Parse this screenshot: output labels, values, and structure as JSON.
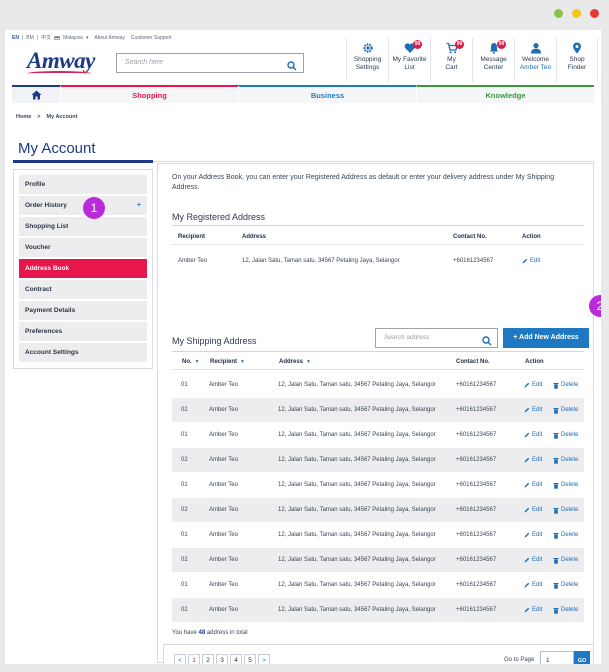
{
  "window": {
    "dots": [
      "#8bc34a",
      "#f5c518",
      "#e53935"
    ]
  },
  "util_bar": {
    "lang_en": "EN",
    "lang_bm": "BM",
    "lang_zh": "中文",
    "country": "Malaysia",
    "about": "About Amway",
    "support": "Customer Support"
  },
  "logo": "Amway",
  "search": {
    "placeholder": "Search here"
  },
  "header_icons": [
    {
      "icon": "gear-icon",
      "line1": "Shopping",
      "line2": "Settings",
      "badge": ""
    },
    {
      "icon": "heart-icon",
      "line1": "My Favorite",
      "line2": "List",
      "badge": "99"
    },
    {
      "icon": "cart-icon",
      "line1": "My",
      "line2": "Cart",
      "badge": "99"
    },
    {
      "icon": "bell-icon",
      "line1": "Message",
      "line2": "Center",
      "badge": "99"
    },
    {
      "icon": "user-icon",
      "line1": "Welcome",
      "line2": "Amber Teo",
      "badge": ""
    },
    {
      "icon": "map-pin-icon",
      "line1": "Shop",
      "line2": "Finder",
      "badge": ""
    }
  ],
  "nav": {
    "items": [
      {
        "label": "Shopping",
        "color": "#e8174b"
      },
      {
        "label": "Business",
        "color": "#1f79c2"
      },
      {
        "label": "Knowledge",
        "color": "#3a9a3a"
      }
    ]
  },
  "breadcrumb": {
    "home": "Home",
    "sep": ">",
    "current": "My Account"
  },
  "page_title": "My Account",
  "sidebar": {
    "items": [
      {
        "label": "Profile"
      },
      {
        "label": "Order History",
        "plus": "+"
      },
      {
        "label": "Shopping List"
      },
      {
        "label": "Voucher"
      },
      {
        "label": "Address Book"
      },
      {
        "label": "Contract"
      },
      {
        "label": "Payment Details"
      },
      {
        "label": "Preferences"
      },
      {
        "label": "Account Settings"
      }
    ],
    "active_index": 4
  },
  "markers": {
    "one": "1",
    "two": "2"
  },
  "intro_text": "On your Address Book, you can enter your Registered Address as default or enter your delivery address under My Shipping Address.",
  "registered": {
    "title": "My Registered Address",
    "headers": {
      "recipient": "Recipient",
      "address": "Address",
      "contact": "Contact No.",
      "action": "Action"
    },
    "row": {
      "recipient": "Amber Teo",
      "address": "12, Jalan Satu, Taman satu, 34567 Petaling Jaya, Selangor",
      "contact": "+60161234567",
      "edit": "Edit"
    }
  },
  "shipping": {
    "title": "My Shipping Address",
    "search_placeholder": "Search address",
    "add_button": "+ Add New Address",
    "headers": {
      "no": "No.",
      "recipient": "Recipient",
      "address": "Address",
      "contact": "Contact No.",
      "action": "Action"
    },
    "edit_label": "Edit",
    "delete_label": "Delete",
    "rows": [
      {
        "no": "01",
        "recipient": "Amber Teo",
        "address": "12, Jalan Satu, Taman satu, 34567 Petaling Jaya, Selangor",
        "contact": "+60161234567"
      },
      {
        "no": "02",
        "recipient": "Amber Teo",
        "address": "12, Jalan Satu, Taman satu, 34567 Petaling Jaya, Selangor",
        "contact": "+60161234567"
      },
      {
        "no": "01",
        "recipient": "Amber Teo",
        "address": "12, Jalan Satu, Taman satu, 34567 Petaling Jaya, Selangor",
        "contact": "+60161234567"
      },
      {
        "no": "02",
        "recipient": "Amber Teo",
        "address": "12, Jalan Satu, Taman satu, 34567 Petaling Jaya, Selangor",
        "contact": "+60161234567"
      },
      {
        "no": "01",
        "recipient": "Amber Teo",
        "address": "12, Jalan Satu, Taman satu, 34567 Petaling Jaya, Selangor",
        "contact": "+60161234567"
      },
      {
        "no": "02",
        "recipient": "Amber Teo",
        "address": "12, Jalan Satu, Taman satu, 34567 Petaling Jaya, Selangor",
        "contact": "+60161234567"
      },
      {
        "no": "01",
        "recipient": "Amber Teo",
        "address": "12, Jalan Satu, Taman satu, 34567 Petaling Jaya, Selangor",
        "contact": "+60161234567"
      },
      {
        "no": "02",
        "recipient": "Amber Teo",
        "address": "12, Jalan Satu, Taman satu, 34567 Petaling Jaya, Selangor",
        "contact": "+60161234567"
      },
      {
        "no": "01",
        "recipient": "Amber Teo",
        "address": "12, Jalan Satu, Taman satu, 34567 Petaling Jaya, Selangor",
        "contact": "+60161234567"
      },
      {
        "no": "02",
        "recipient": "Amber Teo",
        "address": "12, Jalan Satu, Taman satu, 34567 Petaling Jaya, Selangor",
        "contact": "+60161234567"
      }
    ],
    "total_prefix": "You have",
    "total_count": "48",
    "total_suffix": "address in total"
  },
  "pagination": {
    "prev": "<",
    "pages": [
      "1",
      "2",
      "3",
      "4",
      "5"
    ],
    "next": ">",
    "current": "1",
    "goto_label": "Go to Page",
    "goto_value": "1",
    "go_button": "GO"
  }
}
